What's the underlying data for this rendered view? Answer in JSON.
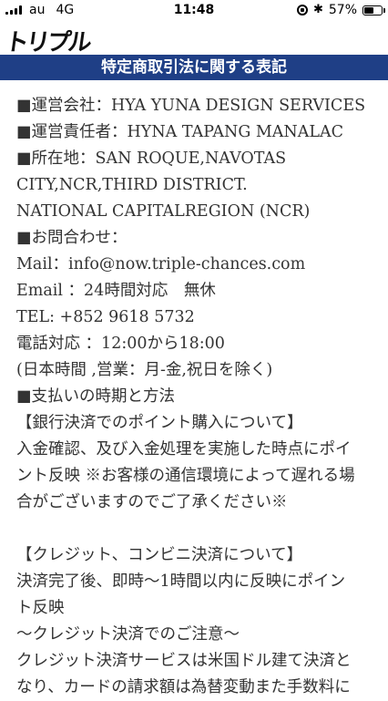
{
  "status_bar": {
    "carrier": "au",
    "network": "4G",
    "time": "11:48",
    "battery_level": 0.57,
    "battery_text": "57%"
  },
  "header": {
    "logo_text": "トリプル"
  },
  "page": {
    "title": "特定商取引法に関する表記"
  },
  "content": {
    "lines": [
      "■運営会社：HYA YUNA DESIGN SERVICES",
      "■運営責任者：HYNA TAPANG MANALAC",
      "■所在地：SAN ROQUE,NAVOTAS",
      "CITY,NCR,THIRD DISTRICT.",
      "NATIONAL CAPITALREGION (NCR)",
      "■お問合わせ：",
      "Mail：info@now.triple-chances.com",
      "Email ：24時間対応　無休",
      "TEL: +852 9618 5732",
      "電話対応 ：12:00から18:00",
      "(日本時間 ,営業：月-金,祝日を除く)",
      "■支払いの時期と方法",
      "【銀行決済でのポイント購入について】",
      "入金確認、及び入金処理を実施した時点にポイ",
      "ント反映 ※お客様の通信環境によって遅れる場",
      "合がございますのでご了承ください※",
      "",
      "【クレジット、コンビニ決済について】",
      "決済完了後、即時〜1時間以内に反映にポイン",
      "ト反映",
      "〜クレジット決済でのご注意〜",
      "クレジット決済サービスは米国ドル建て決済と",
      "なり、カードの請求額は為替変動また手数料に"
    ]
  }
}
